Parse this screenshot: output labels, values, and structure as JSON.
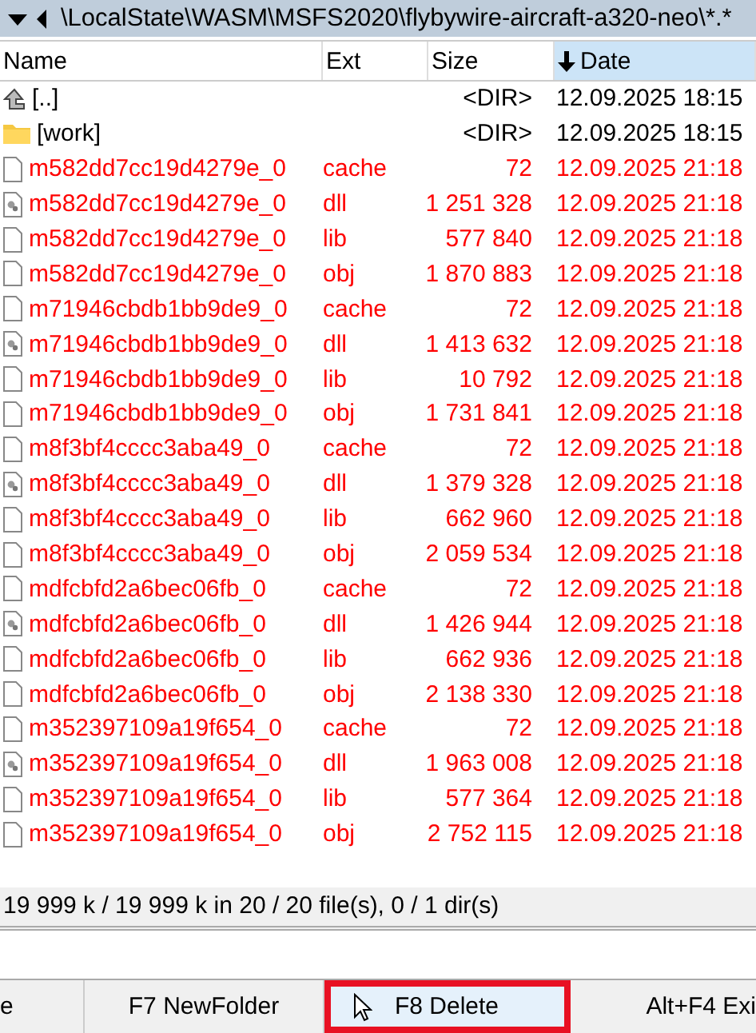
{
  "path_bar": {
    "path": "\\LocalState\\WASM\\MSFS2020\\flybywire-aircraft-a320-neo\\*.*"
  },
  "columns": [
    {
      "label": "Name",
      "sorted": false
    },
    {
      "label": "Ext",
      "sorted": false
    },
    {
      "label": "Size",
      "sorted": false
    },
    {
      "label": "Date",
      "sorted": true
    }
  ],
  "rows": [
    {
      "kind": "up",
      "name": "[..]",
      "ext": "",
      "size": "<DIR>",
      "date": "12.09.2025 18:15",
      "color": "#000000"
    },
    {
      "kind": "folder",
      "name": "[work]",
      "ext": "",
      "size": "<DIR>",
      "date": "12.09.2025 18:15",
      "color": "#000000"
    },
    {
      "kind": "file",
      "name": "m582dd7cc19d4279e_0",
      "ext": "cache",
      "size": "72",
      "date": "12.09.2025 21:18",
      "color": "#ff0000"
    },
    {
      "kind": "dll",
      "name": "m582dd7cc19d4279e_0",
      "ext": "dll",
      "size": "1 251 328",
      "date": "12.09.2025 21:18",
      "color": "#ff0000"
    },
    {
      "kind": "file",
      "name": "m582dd7cc19d4279e_0",
      "ext": "lib",
      "size": "577 840",
      "date": "12.09.2025 21:18",
      "color": "#ff0000"
    },
    {
      "kind": "file",
      "name": "m582dd7cc19d4279e_0",
      "ext": "obj",
      "size": "1 870 883",
      "date": "12.09.2025 21:18",
      "color": "#ff0000"
    },
    {
      "kind": "file",
      "name": "m71946cbdb1bb9de9_0",
      "ext": "cache",
      "size": "72",
      "date": "12.09.2025 21:18",
      "color": "#ff0000"
    },
    {
      "kind": "dll",
      "name": "m71946cbdb1bb9de9_0",
      "ext": "dll",
      "size": "1 413 632",
      "date": "12.09.2025 21:18",
      "color": "#ff0000"
    },
    {
      "kind": "file",
      "name": "m71946cbdb1bb9de9_0",
      "ext": "lib",
      "size": "10 792",
      "date": "12.09.2025 21:18",
      "color": "#ff0000"
    },
    {
      "kind": "file",
      "name": "m71946cbdb1bb9de9_0",
      "ext": "obj",
      "size": "1 731 841",
      "date": "12.09.2025 21:18",
      "color": "#ff0000"
    },
    {
      "kind": "file",
      "name": "m8f3bf4cccc3aba49_0",
      "ext": "cache",
      "size": "72",
      "date": "12.09.2025 21:18",
      "color": "#ff0000"
    },
    {
      "kind": "dll",
      "name": "m8f3bf4cccc3aba49_0",
      "ext": "dll",
      "size": "1 379 328",
      "date": "12.09.2025 21:18",
      "color": "#ff0000"
    },
    {
      "kind": "file",
      "name": "m8f3bf4cccc3aba49_0",
      "ext": "lib",
      "size": "662 960",
      "date": "12.09.2025 21:18",
      "color": "#ff0000"
    },
    {
      "kind": "file",
      "name": "m8f3bf4cccc3aba49_0",
      "ext": "obj",
      "size": "2 059 534",
      "date": "12.09.2025 21:18",
      "color": "#ff0000"
    },
    {
      "kind": "file",
      "name": "mdfcbfd2a6bec06fb_0",
      "ext": "cache",
      "size": "72",
      "date": "12.09.2025 21:18",
      "color": "#ff0000"
    },
    {
      "kind": "dll",
      "name": "mdfcbfd2a6bec06fb_0",
      "ext": "dll",
      "size": "1 426 944",
      "date": "12.09.2025 21:18",
      "color": "#ff0000"
    },
    {
      "kind": "file",
      "name": "mdfcbfd2a6bec06fb_0",
      "ext": "lib",
      "size": "662 936",
      "date": "12.09.2025 21:18",
      "color": "#ff0000"
    },
    {
      "kind": "file",
      "name": "mdfcbfd2a6bec06fb_0",
      "ext": "obj",
      "size": "2 138 330",
      "date": "12.09.2025 21:18",
      "color": "#ff0000"
    },
    {
      "kind": "file",
      "name": "m352397109a19f654_0",
      "ext": "cache",
      "size": "72",
      "date": "12.09.2025 21:18",
      "color": "#ff0000"
    },
    {
      "kind": "dll",
      "name": "m352397109a19f654_0",
      "ext": "dll",
      "size": "1 963 008",
      "date": "12.09.2025 21:18",
      "color": "#ff0000"
    },
    {
      "kind": "file",
      "name": "m352397109a19f654_0",
      "ext": "lib",
      "size": "577 364",
      "date": "12.09.2025 21:18",
      "color": "#ff0000"
    },
    {
      "kind": "file",
      "name": "m352397109a19f654_0",
      "ext": "obj",
      "size": "2 752 115",
      "date": "12.09.2025 21:18",
      "color": "#ff0000"
    }
  ],
  "status_bar": "19 999 k / 19 999 k in 20 / 20 file(s), 0 / 1 dir(s)",
  "function_keys": [
    {
      "label": "e",
      "highlighted": false
    },
    {
      "label": "F7 NewFolder",
      "highlighted": false
    },
    {
      "label": "F8 Delete",
      "highlighted": true
    },
    {
      "label": "Alt+F4 Exi",
      "highlighted": false
    }
  ]
}
